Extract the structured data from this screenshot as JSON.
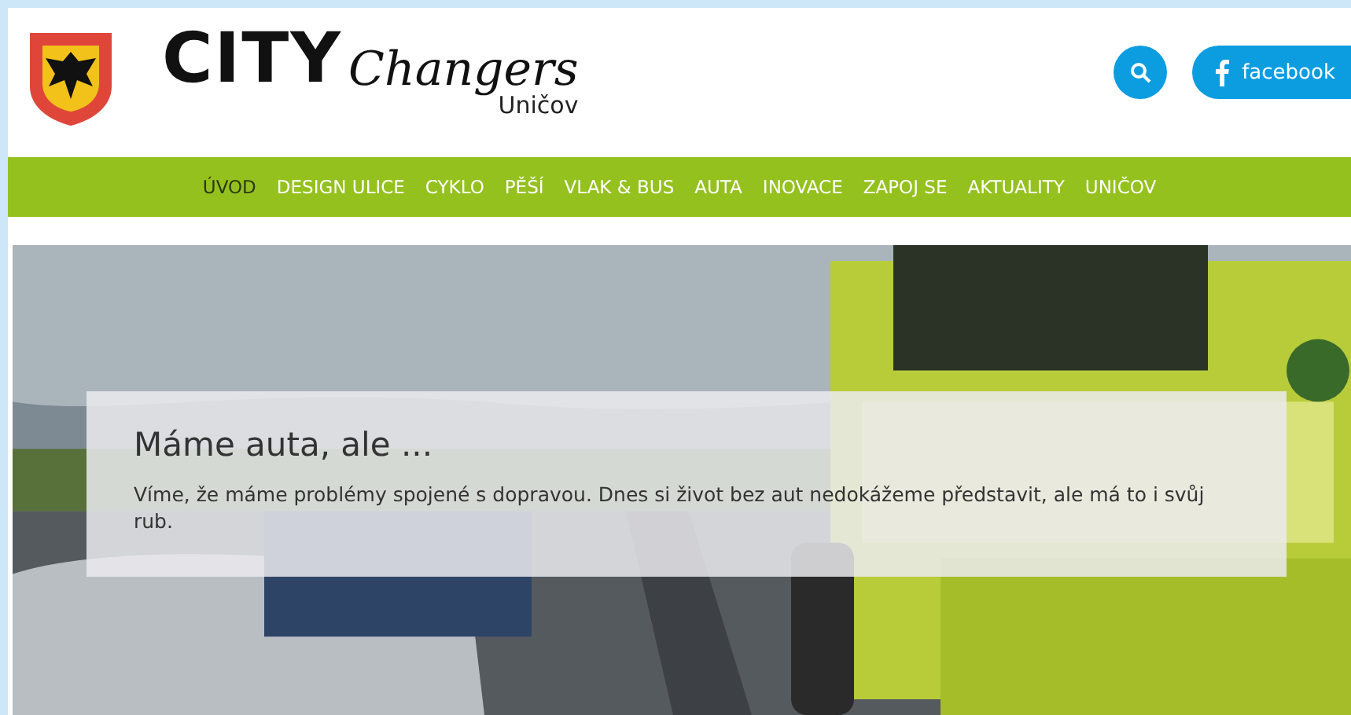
{
  "header": {
    "logo_bold": "CITY",
    "logo_script": "Changers",
    "logo_town": "Uničov",
    "facebook": "facebook"
  },
  "nav": [
    {
      "label": "ÚVOD",
      "selected": true
    },
    {
      "label": "DESIGN ULICE",
      "selected": false
    },
    {
      "label": "CYKLO",
      "selected": false
    },
    {
      "label": "PĚŠÍ",
      "selected": false
    },
    {
      "label": "VLAK & BUS",
      "selected": false
    },
    {
      "label": "AUTA",
      "selected": false
    },
    {
      "label": "INOVACE",
      "selected": false
    },
    {
      "label": "ZAPOJ SE",
      "selected": false
    },
    {
      "label": "AKTUALITY",
      "selected": false
    },
    {
      "label": "UNIČOV",
      "selected": false
    }
  ],
  "hero": {
    "kind": "picture",
    "title": "Máme auta, ale ...",
    "text": "Víme, že máme problémy spojené s dopravou. Dnes si život bez aut nedokážeme představit, ale má to i svůj rub."
  }
}
